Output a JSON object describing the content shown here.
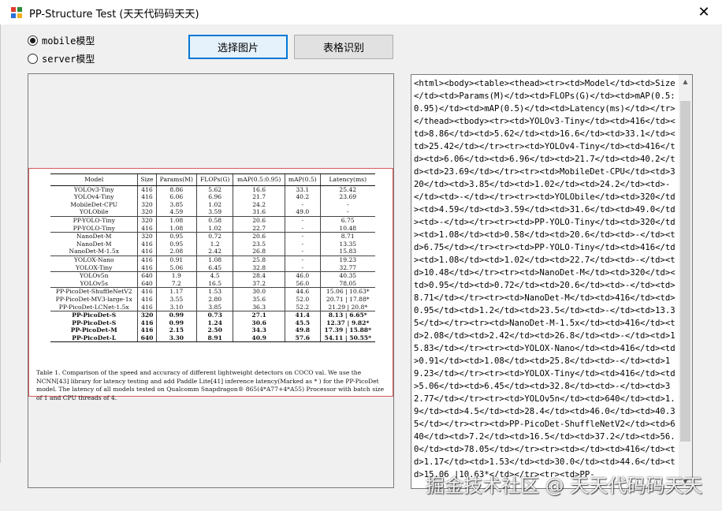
{
  "window": {
    "title": "PP-Structure Test  (天天代码码天天)",
    "close_glyph": "✕"
  },
  "radios": [
    {
      "label": "mobile模型",
      "checked": true
    },
    {
      "label": "server模型",
      "checked": false
    }
  ],
  "buttons": {
    "select_image": "选择图片",
    "table_recognize": "表格识别"
  },
  "paper_table": {
    "headers": [
      "Model",
      "Size",
      "Params(M)",
      "FLOPs(G)",
      "mAP(0.5:0.95)",
      "mAP(0.5)",
      "Latency(ms)"
    ],
    "rows": [
      [
        "YOLOv3-Tiny",
        "416",
        "8.86",
        "5.62",
        "16.6",
        "33.1",
        "25.42"
      ],
      [
        "YOLOv4-Tiny",
        "416",
        "6.06",
        "6.96",
        "21.7",
        "40.2",
        "23.69"
      ],
      [
        "MobileDet-CPU",
        "320",
        "3.85",
        "1.02",
        "24.2",
        "-",
        "-"
      ],
      [
        "YOLObile",
        "320",
        "4.59",
        "3.59",
        "31.6",
        "49.0",
        "-"
      ],
      [
        "PP-YOLO-Tiny",
        "320",
        "1.08",
        "0.58",
        "20.6",
        "-",
        "6.75"
      ],
      [
        "PP-YOLO-Tiny",
        "416",
        "1.08",
        "1.02",
        "22.7",
        "-",
        "10.48"
      ],
      [
        "NanoDet-M",
        "320",
        "0.95",
        "0.72",
        "20.6",
        "-",
        "8.71"
      ],
      [
        "NanoDet-M",
        "416",
        "0.95",
        "1.2",
        "23.5",
        "-",
        "13.35"
      ],
      [
        "NanoDet-M-1.5x",
        "416",
        "2.08",
        "2.42",
        "26.8",
        "-",
        "15.83"
      ],
      [
        "YOLOX-Nano",
        "416",
        "0.91",
        "1.08",
        "25.8",
        "-",
        "19.23"
      ],
      [
        "YOLOX-Tiny",
        "416",
        "5.06",
        "6.45",
        "32.8",
        "-",
        "32.77"
      ],
      [
        "YOLOv5n",
        "640",
        "1.9",
        "4.5",
        "28.4",
        "46.0",
        "40.35"
      ],
      [
        "YOLOv5s",
        "640",
        "7.2",
        "16.5",
        "37.2",
        "56.0",
        "78.05"
      ],
      [
        "PP-PicoDet-ShuffleNetV2",
        "416",
        "1.17",
        "1.53",
        "30.0",
        "44.6",
        "15.06 | 10.63*"
      ],
      [
        "PP-PicoDet-MV3-large-1x",
        "416",
        "3.55",
        "2.80",
        "35.6",
        "52.0",
        "20.71 | 17.88*"
      ],
      [
        "PP-PicoDet-LCNet-1.5x",
        "416",
        "3.10",
        "3.85",
        "36.3",
        "52.2",
        "21.29 | 20.8*"
      ],
      [
        "PP-PicoDet-S",
        "320",
        "0.99",
        "0.73",
        "27.1",
        "41.4",
        "8.13 | 6.65*"
      ],
      [
        "PP-PicoDet-S",
        "416",
        "0.99",
        "1.24",
        "30.6",
        "45.5",
        "12.37 | 9.82*"
      ],
      [
        "PP-PicoDet-M",
        "416",
        "2.15",
        "2.50",
        "34.3",
        "49.8",
        "17.39 | 15.88*"
      ],
      [
        "PP-PicoDet-L",
        "640",
        "3.30",
        "8.91",
        "40.9",
        "57.6",
        "54.11 | 50.55*"
      ]
    ],
    "caption": "Table 1. Comparison of the speed and accuracy of different lightweight detectors on COCO val. We use the NCNN[43] library for latency testing and add Paddle Lite[41] inference latency(Marked as * ) for the PP-PicoDet model. The latency of all models tested on Qualcomm Snapdragon® 865(4*A77+4*A55) Processor with batch size of 1 and CPU threads of 4."
  },
  "result_text": "<html><body><table><thead><tr><td>Model</td><td>Size</td><td>Params(M)</td><td>FLOPs(G)</td><td>mAP(0.5:0.95)</td><td>mAP(0.5)</td><td>Latency(ms)</td></tr></thead><tbody><tr><td>YOLOv3-Tiny</td><td>416</td><td>8.86</td><td>5.62</td><td>16.6</td><td>33.1</td><td>25.42</td></tr><tr><td>YOLOv4-Tiny</td><td>416</td><td>6.06</td><td>6.96</td><td>21.7</td><td>40.2</td><td>23.69</td></tr><tr><td>MobileDet-CPU</td><td>320</td><td>3.85</td><td>1.02</td><td>24.2</td><td>-</td><td>-</td></tr><tr><td>YOLObile</td><td>320</td><td>4.59</td><td>3.59</td><td>31.6</td><td>49.0</td><td>-</td></tr><tr><td>PP-YOLO-Tiny</td><td>320</td><td>1.08</td><td>0.58</td><td>20.6</td><td>-</td><td>6.75</td></tr><tr><td>PP-YOLO-Tiny</td><td>416</td><td>1.08</td><td>1.02</td><td>22.7</td><td>-</td><td>10.48</td></tr><tr><td>NanoDet-M</td><td>320</td><td>0.95</td><td>0.72</td><td>20.6</td><td>-</td><td>8.71</td></tr><tr><td>NanoDet-M</td><td>416</td><td>0.95</td><td>1.2</td><td>23.5</td><td>-</td><td>13.35</td></tr><tr><td>NanoDet-M-1.5x</td><td>416</td><td>2.08</td><td>2.42</td><td>26.8</td><td>-</td><td>15.83</td></tr><tr><td>YOLOX-Nano</td><td>416</td><td>0.91</td><td>1.08</td><td>25.8</td><td>-</td><td>19.23</td></tr><tr><td>YOLOX-Tiny</td><td>416</td><td>5.06</td><td>6.45</td><td>32.8</td><td>-</td><td>32.77</td></tr><tr><td>YOLOv5n</td><td>640</td><td>1.9</td><td>4.5</td><td>28.4</td><td>46.0</td><td>40.35</td></tr><tr><td>PP-PicoDet-ShuffleNetV2</td><td>640</td><td>7.2</td><td>16.5</td><td>37.2</td><td>56.0</td><td>78.05</td></tr><tr><td></td><td>416</td><td>1.17</td><td>1.53</td><td>30.0</td><td>44.6</td><td>15.06 |10.63*</td></tr><tr><td>PP-",
  "watermark": "掘金技术社区 @ 天天代码码天天"
}
